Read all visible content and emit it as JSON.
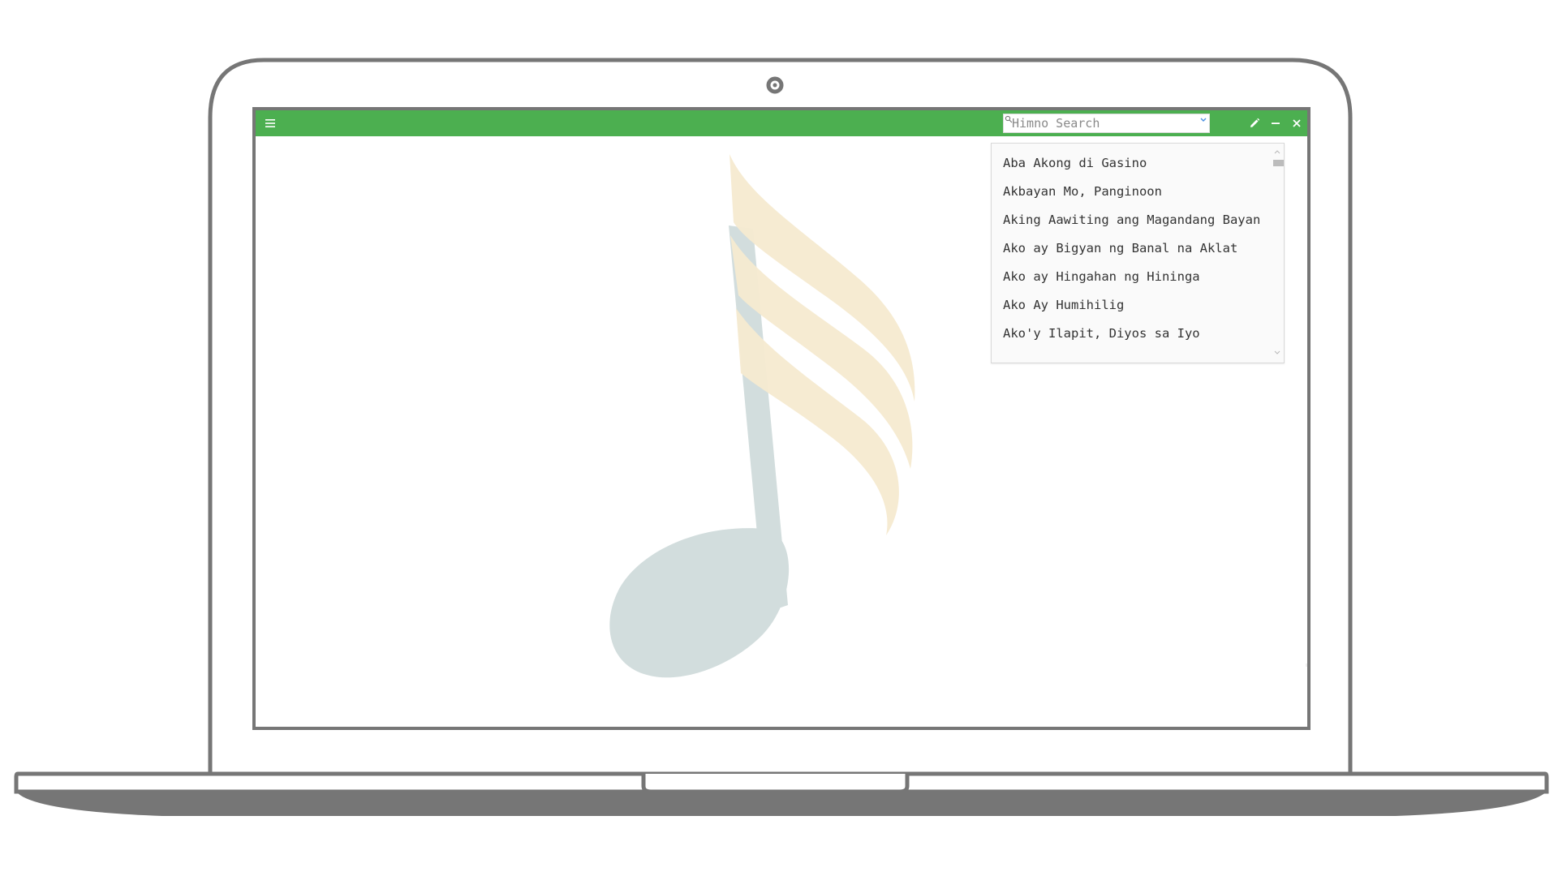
{
  "header": {
    "search": {
      "placeholder": "Himno Search",
      "value": ""
    },
    "icons": [
      "menu-icon",
      "search-icon",
      "chevron-down-icon",
      "pencil-icon",
      "minimize-icon",
      "close-icon"
    ]
  },
  "songs": [
    "Aba Akong di Gasino",
    "Akbayan Mo, Panginoon",
    "Aking Aawiting ang Magandang Bayan",
    "Ako ay Bigyan ng Banal na Aklat",
    "Ako ay Hingahan ng Hininga",
    "Ako Ay Humihilig",
    "Ako'y Ilapit, Diyos sa Iyo"
  ],
  "colors": {
    "header": "#4caf50",
    "watermark_note_stem": "#d2dddd",
    "watermark_note_flags": "#f5ead0",
    "frame": "#767676"
  }
}
